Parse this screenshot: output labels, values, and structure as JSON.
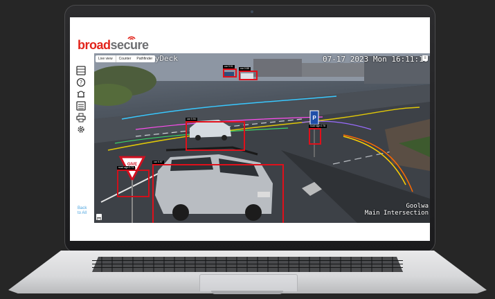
{
  "app": {
    "brand_part1": "broad",
    "brand_part2": "secure",
    "brand_colors": {
      "red": "#e2231a",
      "grey": "#6d6e71"
    },
    "back_link": "Back to All"
  },
  "sidebar": {
    "items": [
      {
        "icon": "camera-grid-icon"
      },
      {
        "icon": "help-icon"
      },
      {
        "icon": "alarm-bell-icon"
      },
      {
        "icon": "list-view-icon"
      },
      {
        "icon": "print-icon"
      },
      {
        "icon": "settings-gear-icon"
      }
    ]
  },
  "video": {
    "tabs": [
      "Live view",
      "Counter",
      "Pathfinder"
    ],
    "active_tab": "Live view",
    "osd_title": "artCityDeck",
    "osd_clock": "07-17 2023 Mon 16:11:10",
    "osd_location_line1": "Goolwa",
    "osd_location_line2": "Main Intersection",
    "detections": [
      {
        "label": "car 0.91",
        "kind": "car-far-1"
      },
      {
        "label": "car 0.88",
        "kind": "car-far-2"
      },
      {
        "label": "car 0.94",
        "kind": "car-mid"
      },
      {
        "label": "road sign 0.78",
        "kind": "parking-sign"
      },
      {
        "label": "road sign 0.73",
        "kind": "give-way-sign"
      },
      {
        "label": "car 0.97",
        "kind": "suv-near"
      }
    ]
  }
}
